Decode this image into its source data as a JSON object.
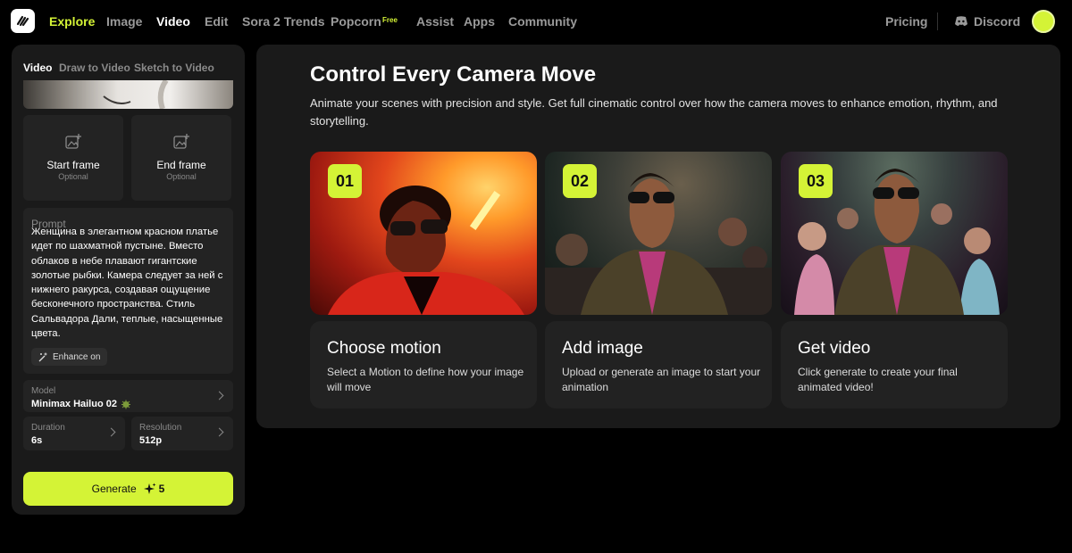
{
  "nav": {
    "items": [
      "Explore",
      "Image",
      "Video",
      "Edit",
      "Sora 2 Trends",
      "Popcorn",
      "Assist",
      "Apps",
      "Community"
    ],
    "free_badge": "Free",
    "pricing": "Pricing",
    "discord": "Discord"
  },
  "left_panel": {
    "tabs": [
      "Video",
      "Draw to Video",
      "Sketch to Video"
    ],
    "start_frame": {
      "title": "Start frame",
      "sub": "Optional"
    },
    "end_frame": {
      "title": "End frame",
      "sub": "Optional"
    },
    "prompt_label": "Prompt",
    "prompt_text": "Женщина в элегантном красном платье идет по шахматной пустыне. Вместо облаков в небе плавают гигантские золотые рыбки. Камера следует за ней с нижнего ракурса, создавая ощущение бесконечного пространства. Стиль Сальвадора Дали, теплые, насыщенные цвета.",
    "enhance": "Enhance on",
    "model_label": "Model",
    "model_value": "Minimax Hailuo 02",
    "duration_label": "Duration",
    "duration_value": "6s",
    "resolution_label": "Resolution",
    "resolution_value": "512p",
    "generate_label": "Generate",
    "generate_cost": "5"
  },
  "main": {
    "title": "Control Every Camera Move",
    "description": "Animate your scenes with precision and style. Get full cinematic control over how the camera moves to enhance emotion, rhythm, and storytelling.",
    "cards": [
      {
        "number": "01",
        "title": "Choose motion",
        "text": "Select a Motion to define how your image will move"
      },
      {
        "number": "02",
        "title": "Add image",
        "text": "Upload or generate an image to start your animation"
      },
      {
        "number": "03",
        "title": "Get video",
        "text": "Click generate to create your final animated video!"
      }
    ]
  },
  "colors": {
    "accent": "#d4f336",
    "panel": "#1a1a1a",
    "card": "#222222"
  },
  "icons": [
    "app-logo-icon",
    "discord-icon",
    "image-add-icon",
    "magic-wand-icon",
    "sparkle-icon",
    "chevron-right-icon"
  ]
}
